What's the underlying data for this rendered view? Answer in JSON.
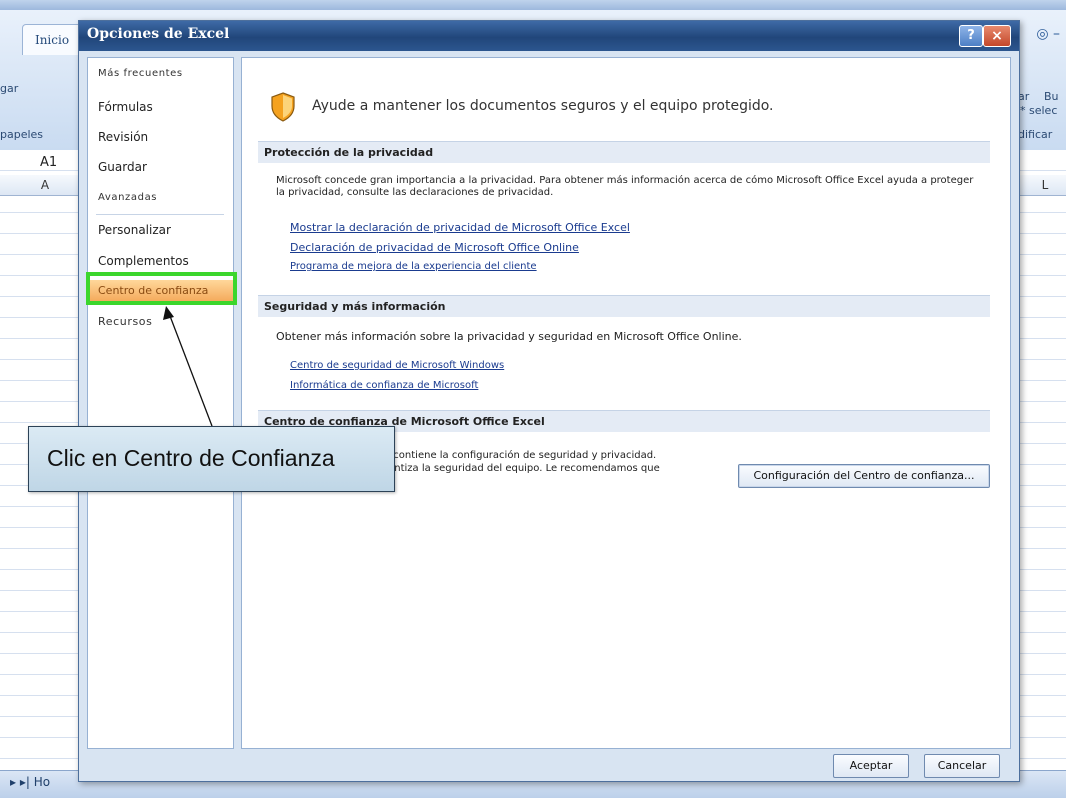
{
  "excel": {
    "tab_inicio": "Inicio",
    "pegar": "gar",
    "portapapeles": "papeles",
    "cell_ref": "A1",
    "col_a": "A",
    "col_l": "L",
    "right_ribbon_1": "ar",
    "right_ribbon_2": "Bu",
    "right_ribbon_3": "* selec",
    "right_ribbon_4": "dificar",
    "sheet_tab": "Ho"
  },
  "dialog": {
    "title": "Opciones de Excel",
    "help_glyph": "?",
    "close_glyph": "×",
    "nav": [
      {
        "label": "Más frecuentes",
        "small": true
      },
      {
        "label": "Fórmulas",
        "small": false
      },
      {
        "label": "Revisión",
        "small": false
      },
      {
        "label": "Guardar",
        "small": false
      },
      {
        "label": "Avanzadas",
        "small": true
      },
      {
        "label": "Personalizar",
        "small": false
      },
      {
        "label": "Complementos",
        "small": false
      },
      {
        "label": "Centro de confianza",
        "small": false,
        "selected": true
      },
      {
        "label": "Recursos",
        "small": false
      }
    ],
    "heading": "Ayude a mantener los documentos seguros y el equipo protegido.",
    "sections": {
      "privacy": {
        "title": "Protección de la privacidad",
        "text": "Microsoft concede gran importancia a la privacidad. Para obtener más información acerca de cómo Microsoft Office Excel ayuda a proteger la privacidad, consulte las declaraciones de privacidad.",
        "links": [
          "Mostrar la declaración de privacidad de Microsoft Office Excel",
          "Declaración de privacidad de Microsoft Office Online",
          "Programa de mejora de la experiencia del cliente"
        ]
      },
      "security": {
        "title": "Seguridad y más información",
        "text": "Obtener más información sobre la privacidad y seguridad en Microsoft Office Online.",
        "links": [
          "Centro de seguridad de Microsoft Windows",
          "Informática de confianza de Microsoft"
        ]
      },
      "trust": {
        "title": "Centro de confianza de Microsoft Office Excel",
        "text_line1": "a contiene la configuración de seguridad y privacidad.",
        "text_line2": "rantiza la seguridad del equipo. Le recomendamos que",
        "button": "Configuración del Centro de confianza..."
      }
    },
    "ok_button": "Aceptar",
    "cancel_button": "Cancelar"
  },
  "callout": {
    "text": "Clic en Centro de Confianza"
  },
  "colors": {
    "highlight": "#3bd62c",
    "selected_nav": "#f4a95a",
    "title_bar": "#21467a"
  }
}
